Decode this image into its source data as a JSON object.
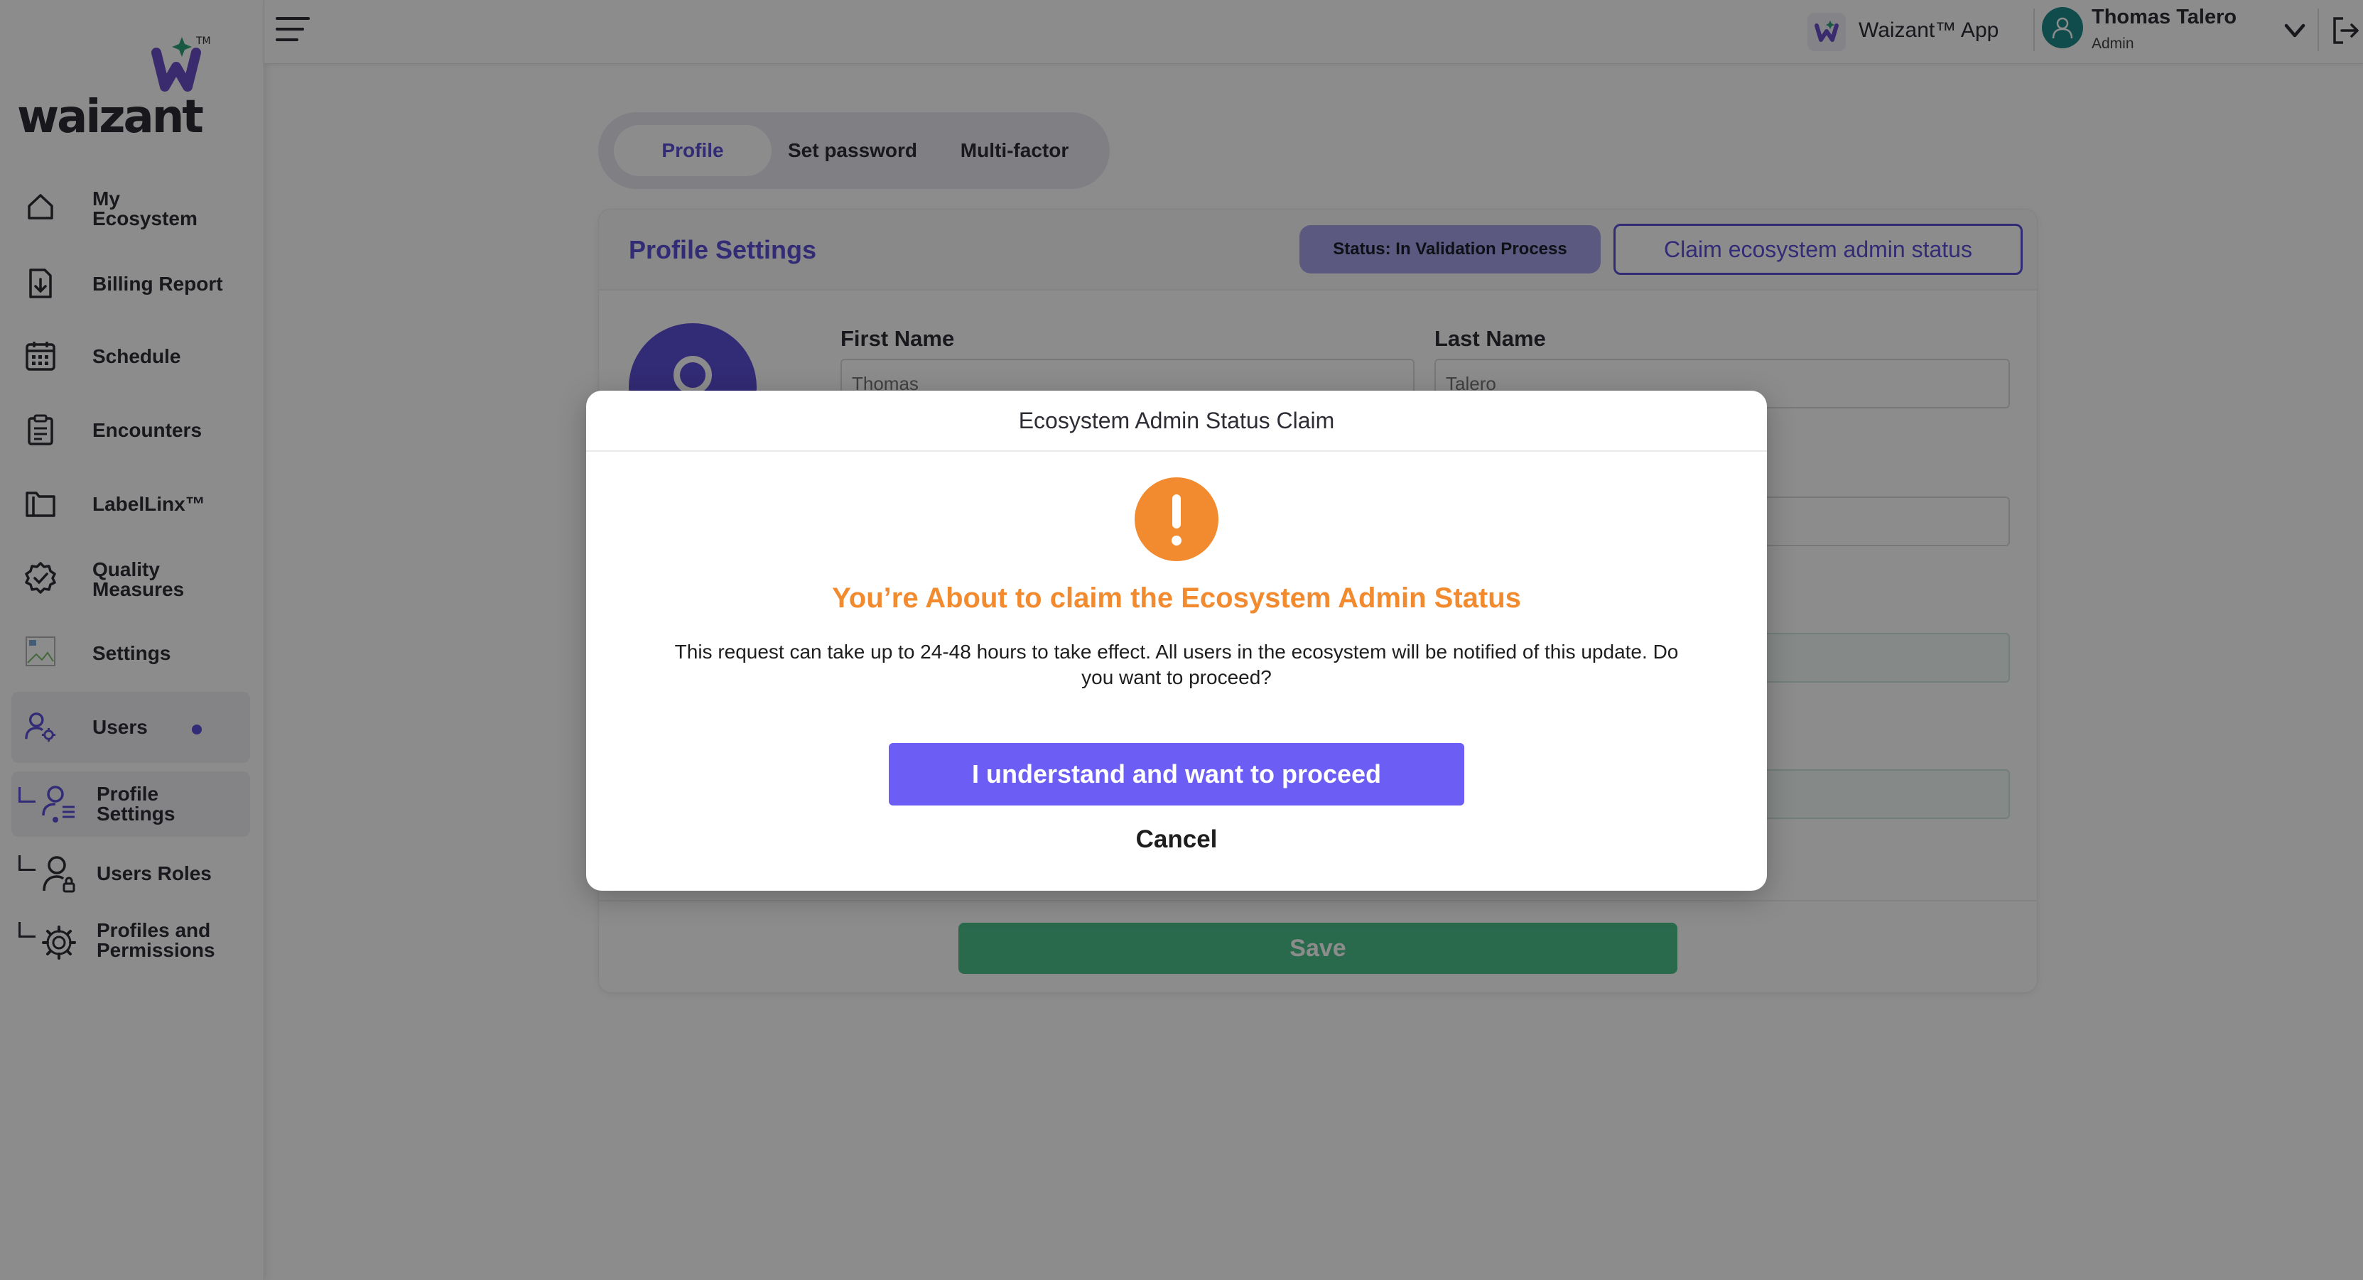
{
  "brand": {
    "logo_text": "waizant",
    "logo_mark": "W",
    "trademark": "TM",
    "colors": {
      "primary": "#5c4fd6",
      "button": "#6c5ef5",
      "warning": "#f28b2f",
      "save": "#4cbf8b",
      "avatar": "#1f8a8c"
    }
  },
  "sidebar": {
    "items": [
      {
        "label": "My Ecosystem",
        "icon": "home-icon"
      },
      {
        "label": "Billing Report",
        "icon": "file-download-icon"
      },
      {
        "label": "Schedule",
        "icon": "calendar-icon"
      },
      {
        "label": "Encounters",
        "icon": "clipboard-icon"
      },
      {
        "label": "LabelLinx™",
        "icon": "folder-icon"
      },
      {
        "label": "Quality Measures",
        "icon": "badge-check-icon"
      },
      {
        "label": "Settings",
        "icon": "broken-image-icon"
      },
      {
        "label": "Users",
        "icon": "users-gear-icon"
      }
    ],
    "sub_items": [
      {
        "label": "Profile Settings",
        "icon": "profile-settings-icon"
      },
      {
        "label": "Users Roles",
        "icon": "user-lock-icon"
      },
      {
        "label": "Profiles and Permissions",
        "icon": "gear-icon"
      }
    ]
  },
  "topbar": {
    "app_name": "Waizant™ App",
    "user_name": "Thomas Talero",
    "user_role": "Admin"
  },
  "tabs": [
    {
      "label": "Profile",
      "active": true
    },
    {
      "label": "Set password",
      "active": false
    },
    {
      "label": "Multi-factor",
      "active": false
    }
  ],
  "profile": {
    "title": "Profile Settings",
    "status": "Status: In Validation Process",
    "claim_button": "Claim ecosystem admin status",
    "first_name_label": "First Name",
    "first_name_value": "Thomas",
    "last_name_label": "Last Name",
    "last_name_value": "Talero",
    "save_label": "Save"
  },
  "modal": {
    "title": "Ecosystem Admin Status Claim",
    "heading": "You’re About to claim the Ecosystem Admin Status",
    "body": "This request can take up to 24-48 hours to take effect. All users in the ecosystem will be notified of this update. Do you want to proceed?",
    "confirm_label": "I understand and want to proceed",
    "cancel_label": "Cancel"
  }
}
